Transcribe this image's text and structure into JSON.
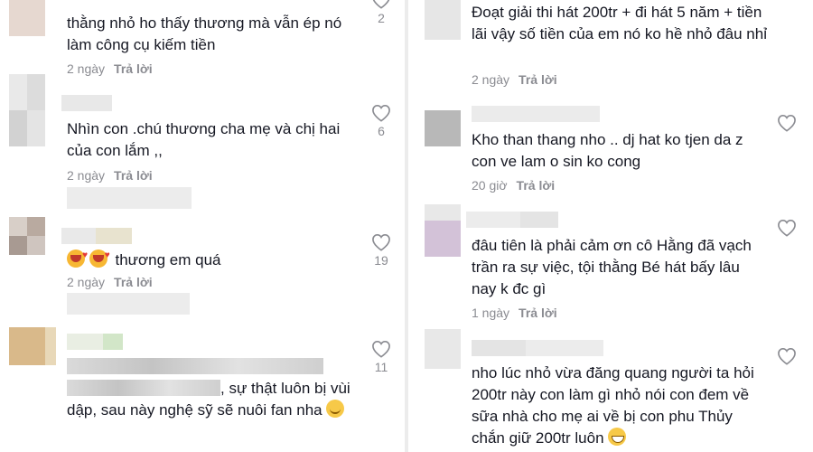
{
  "left_column": {
    "comments": [
      {
        "text": "thằng nhỏ ho thấy thương mà vẫn ép nó làm công cụ kiếm tiền",
        "time": "2 ngày",
        "reply": "Trả lời",
        "likes": "2"
      },
      {
        "text": "Nhìn con .chú thương cha mẹ và chị hai của con lắm ,,",
        "time": "2 ngày",
        "reply": "Trả lời",
        "likes": "6"
      },
      {
        "text": "thương em quá",
        "emoji": "smiling-face-with-hearts",
        "time": "2 ngày",
        "reply": "Trả lời",
        "likes": "19"
      },
      {
        "text_visible": ", sự thật luôn bị vùi dập, sau này nghệ sỹ sẽ nuôi fan nha",
        "emoji": "relieved-face",
        "likes": "11"
      }
    ]
  },
  "right_column": {
    "comments": [
      {
        "text": "Đoạt giải thi hát 200tr + đi hát 5 năm + tiền lãi vậy số tiền của em nó ko hề nhỏ đâu nhỉ",
        "time": "2 ngày",
        "reply": "Trả lời"
      },
      {
        "text": "Kho than thang nho .. dj hat ko tjen da z con ve lam o sin ko cong",
        "time": "20 giờ",
        "reply": "Trả lời"
      },
      {
        "text": "đâu tiên là phải cảm ơn cô Hằng đã vạch trần ra sự việc, tội thằng Bé hát bấy lâu nay k đc gì",
        "time": "1 ngày",
        "reply": "Trả lời"
      },
      {
        "text": "nho lúc nhỏ vừa đăng quang người ta hỏi 200tr này con làm gì nhỏ nói con đem về sữa nhà cho mẹ ai về bị con phu Thủy chắn giữ 200tr luôn",
        "emoji": "grinning-face"
      }
    ]
  },
  "colors": {
    "text": "#161823",
    "meta": "#8a8b91",
    "divider": "#ececec"
  },
  "icons": {
    "like": "heart-outline-icon"
  }
}
